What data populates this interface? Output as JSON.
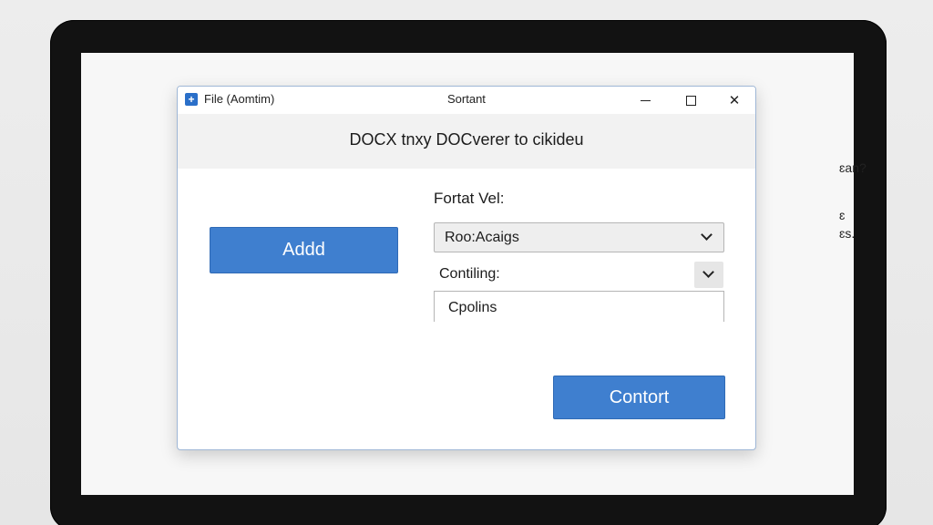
{
  "window": {
    "title": "File (Aomtim)",
    "center_title": "Sortant",
    "minimize_icon": "minimize-icon",
    "maximize_icon": "maximize-icon",
    "close_icon": "close-icon"
  },
  "header": {
    "text": "DOCX tnxy DOCverer to cikideu"
  },
  "actions": {
    "add_label": "Addd",
    "convert_label": "Contort"
  },
  "form": {
    "format_label": "Fortat Vel:",
    "format_value": "Roo:Acaigs",
    "contling_label": "Contiling:",
    "cpolins_value": "Cpolins"
  },
  "background": {
    "line1": "ɛan?",
    "line2": "ɛ",
    "line3": "ɛs."
  },
  "colors": {
    "accent": "#3f7fcf",
    "bezel": "#121212"
  }
}
